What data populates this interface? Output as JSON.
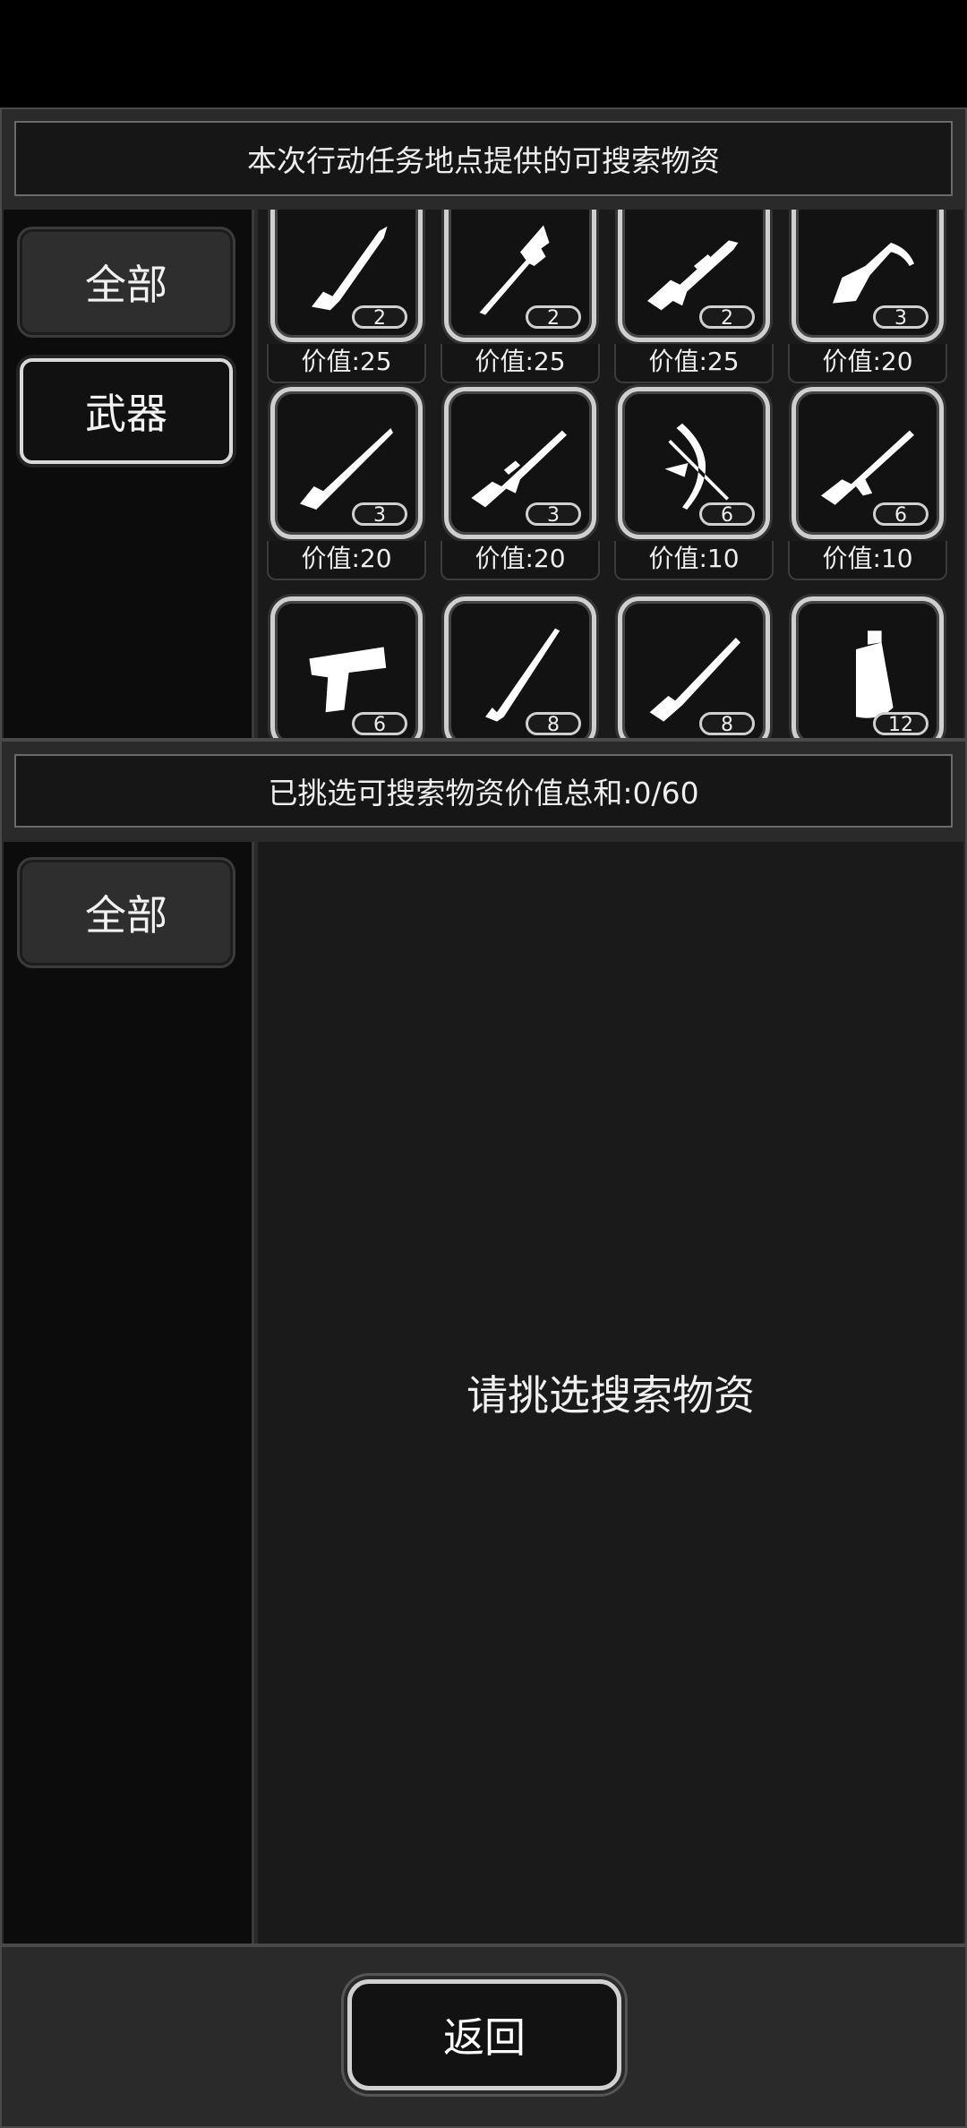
{
  "supply_panel": {
    "title": "本次行动任务地点提供的可搜索物资",
    "tabs": [
      {
        "label": "全部",
        "selected": true
      },
      {
        "label": "武器",
        "selected": false
      }
    ],
    "items": [
      {
        "icon": "knife-icon",
        "count": "2",
        "value_label": "价值:25"
      },
      {
        "icon": "spear-icon",
        "count": "2",
        "value_label": "价值:25"
      },
      {
        "icon": "assault-rifle-scoped-icon",
        "count": "2",
        "value_label": "价值:25"
      },
      {
        "icon": "crossbow-icon",
        "count": "3",
        "value_label": "价值:20"
      },
      {
        "icon": "bolt-action-rifle-icon",
        "count": "3",
        "value_label": "价值:20"
      },
      {
        "icon": "m16-rifle-icon",
        "count": "3",
        "value_label": "价值:20"
      },
      {
        "icon": "compound-bow-icon",
        "count": "6",
        "value_label": "价值:10"
      },
      {
        "icon": "ak47-icon",
        "count": "6",
        "value_label": "价值:10"
      },
      {
        "icon": "pistol-icon",
        "count": "6",
        "value_label": ""
      },
      {
        "icon": "katana-icon",
        "count": "8",
        "value_label": ""
      },
      {
        "icon": "shotgun-icon",
        "count": "8",
        "value_label": ""
      },
      {
        "icon": "grenade-icon",
        "count": "12",
        "value_label": ""
      }
    ]
  },
  "selected_panel": {
    "title": "已挑选可搜索物资价值总和:0/60",
    "tabs": [
      {
        "label": "全部",
        "selected": true
      }
    ],
    "empty_message": "请挑选搜索物资"
  },
  "footer": {
    "back_label": "返回"
  }
}
